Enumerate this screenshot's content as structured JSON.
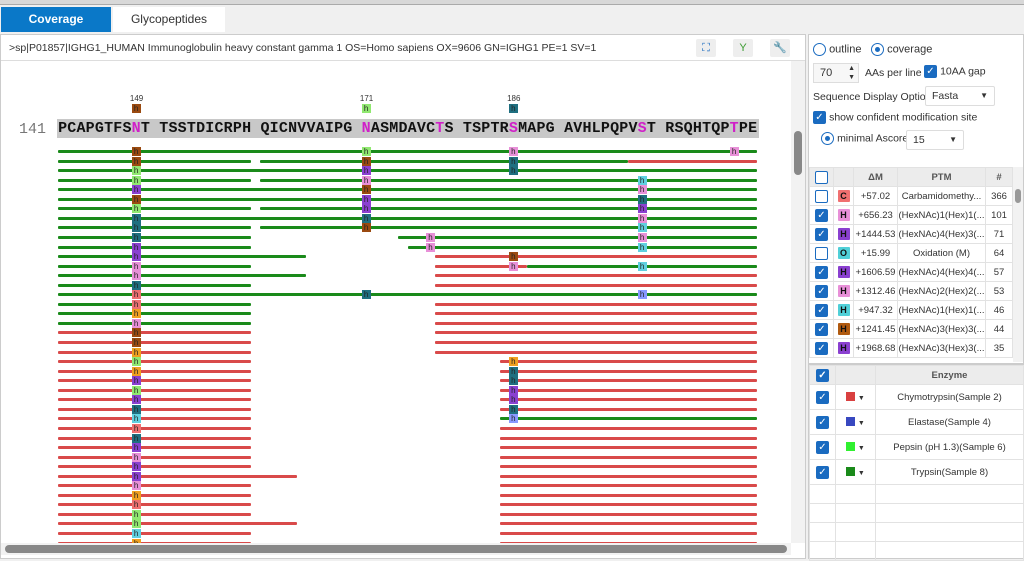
{
  "tabs": [
    {
      "label": "Coverage",
      "active": true
    },
    {
      "label": "Glycopeptides",
      "active": false
    }
  ],
  "header": {
    "title": ">sp|P01857|IGHG1_HUMAN Immunoglobulin heavy constant gamma 1 OS=Homo sapiens OX=9606 GN=IGHG1 PE=1 SV=1",
    "icons": [
      "expand-icon",
      "glycan-icon",
      "wrench-icon"
    ]
  },
  "coverage": {
    "line_start": "141",
    "sequence": "PCAPGTFSNTTSSTDICRPHQICNVVAIPGNASMDAVCTSTSPTRSMAPGAVHLPQPVSTRSQHTQPTPE",
    "highlighted_residues": [
      149,
      171,
      179,
      186,
      199,
      208
    ],
    "site_labels": [
      {
        "pos": 149,
        "label": "149",
        "color": "#9a4a10"
      },
      {
        "pos": 171,
        "label": "171",
        "color": "#90e870"
      },
      {
        "pos": 186,
        "label": "186",
        "color": "#1f6f80"
      }
    ],
    "enzyme_colors": [
      "#d94a4a",
      "#3848c0",
      "#30f030",
      "#1a8a1a"
    ],
    "mod_colors": {
      "br": "#9a4a10",
      "lg": "#90e870",
      "pk": "#e890d8",
      "pu": "#8a40d0",
      "te": "#1f6f80",
      "cy": "#60d0e0",
      "sa": "#ee7070",
      "or": "#f0a020",
      "lv": "#8899ff"
    },
    "rows": [
      {
        "p": [
          [
            141,
            210,
            3
          ]
        ],
        "m": [
          [
            149,
            "br"
          ],
          [
            171,
            "lg"
          ],
          [
            186,
            "pk"
          ],
          [
            208,
            "pk"
          ]
        ]
      },
      {
        "p": [
          [
            141,
            160,
            3
          ],
          [
            161,
            197,
            3
          ],
          [
            198,
            210,
            0
          ]
        ],
        "m": [
          [
            149,
            "br"
          ],
          [
            171,
            "br"
          ],
          [
            186,
            "te"
          ]
        ]
      },
      {
        "p": [
          [
            141,
            210,
            3
          ]
        ],
        "m": [
          [
            149,
            "lg"
          ],
          [
            171,
            "pu"
          ],
          [
            186,
            "te"
          ]
        ]
      },
      {
        "p": [
          [
            141,
            160,
            3
          ],
          [
            161,
            210,
            3
          ]
        ],
        "m": [
          [
            149,
            "lg"
          ],
          [
            171,
            "pk"
          ],
          [
            199,
            "cy"
          ]
        ]
      },
      {
        "p": [
          [
            141,
            210,
            3
          ]
        ],
        "m": [
          [
            149,
            "pu"
          ],
          [
            171,
            "br"
          ],
          [
            199,
            "pk"
          ]
        ]
      },
      {
        "p": [
          [
            141,
            210,
            3
          ]
        ],
        "m": [
          [
            149,
            "br"
          ],
          [
            171,
            "pu"
          ],
          [
            199,
            "te"
          ]
        ]
      },
      {
        "p": [
          [
            141,
            160,
            3
          ],
          [
            161,
            210,
            3
          ]
        ],
        "m": [
          [
            149,
            "lg"
          ],
          [
            171,
            "pu"
          ],
          [
            199,
            "pu"
          ]
        ]
      },
      {
        "p": [
          [
            141,
            210,
            3
          ]
        ],
        "m": [
          [
            149,
            "te"
          ],
          [
            171,
            "te"
          ],
          [
            199,
            "pk"
          ]
        ]
      },
      {
        "p": [
          [
            141,
            160,
            3
          ],
          [
            161,
            210,
            3
          ]
        ],
        "m": [
          [
            149,
            "te"
          ],
          [
            171,
            "br"
          ],
          [
            199,
            "cy"
          ]
        ]
      },
      {
        "p": [
          [
            141,
            160,
            3
          ],
          [
            175,
            210,
            3
          ]
        ],
        "m": [
          [
            149,
            "te"
          ],
          [
            178,
            "pk"
          ],
          [
            199,
            "pk"
          ]
        ]
      },
      {
        "p": [
          [
            141,
            160,
            3
          ],
          [
            176,
            210,
            3
          ]
        ],
        "m": [
          [
            149,
            "pu"
          ],
          [
            178,
            "pk"
          ],
          [
            199,
            "cy"
          ]
        ]
      },
      {
        "p": [
          [
            141,
            165,
            3
          ],
          [
            179,
            210,
            0
          ]
        ],
        "m": [
          [
            149,
            "pu"
          ],
          [
            186,
            "br"
          ]
        ]
      },
      {
        "p": [
          [
            141,
            160,
            3
          ],
          [
            179,
            187,
            0
          ],
          [
            188,
            210,
            3
          ]
        ],
        "m": [
          [
            149,
            "pk"
          ],
          [
            186,
            "pk"
          ],
          [
            199,
            "cy"
          ]
        ]
      },
      {
        "p": [
          [
            141,
            165,
            3
          ],
          [
            179,
            210,
            0
          ]
        ],
        "m": [
          [
            149,
            "pk"
          ]
        ]
      },
      {
        "p": [
          [
            141,
            160,
            3
          ],
          [
            179,
            210,
            0
          ]
        ],
        "m": [
          [
            149,
            "te"
          ]
        ]
      },
      {
        "p": [
          [
            141,
            210,
            3
          ]
        ],
        "m": [
          [
            149,
            "sa"
          ],
          [
            171,
            "te"
          ],
          [
            199,
            "lv"
          ]
        ]
      },
      {
        "p": [
          [
            141,
            160,
            3
          ],
          [
            179,
            210,
            0
          ]
        ],
        "m": [
          [
            149,
            "sa"
          ]
        ]
      },
      {
        "p": [
          [
            141,
            160,
            3
          ],
          [
            179,
            210,
            0
          ]
        ],
        "m": [
          [
            149,
            "or"
          ]
        ]
      },
      {
        "p": [
          [
            141,
            160,
            3
          ],
          [
            179,
            210,
            0
          ]
        ],
        "m": [
          [
            149,
            "pk"
          ]
        ]
      },
      {
        "p": [
          [
            141,
            160,
            0
          ],
          [
            179,
            210,
            0
          ]
        ],
        "m": [
          [
            149,
            "br"
          ]
        ]
      },
      {
        "p": [
          [
            141,
            160,
            0
          ],
          [
            179,
            210,
            0
          ]
        ],
        "m": [
          [
            149,
            "br"
          ]
        ]
      },
      {
        "p": [
          [
            141,
            160,
            0
          ],
          [
            179,
            210,
            0
          ]
        ],
        "m": [
          [
            149,
            "or"
          ]
        ]
      },
      {
        "p": [
          [
            141,
            160,
            0
          ],
          [
            185,
            210,
            0
          ]
        ],
        "m": [
          [
            149,
            "lg"
          ],
          [
            186,
            "or"
          ]
        ]
      },
      {
        "p": [
          [
            141,
            160,
            0
          ],
          [
            185,
            210,
            0
          ]
        ],
        "m": [
          [
            149,
            "or"
          ],
          [
            186,
            "te"
          ]
        ]
      },
      {
        "p": [
          [
            141,
            160,
            0
          ],
          [
            185,
            210,
            0
          ]
        ],
        "m": [
          [
            149,
            "pu"
          ],
          [
            186,
            "te"
          ]
        ]
      },
      {
        "p": [
          [
            141,
            160,
            0
          ],
          [
            185,
            210,
            0
          ]
        ],
        "m": [
          [
            149,
            "lg"
          ],
          [
            186,
            "pu"
          ]
        ]
      },
      {
        "p": [
          [
            141,
            160,
            0
          ],
          [
            185,
            210,
            0
          ]
        ],
        "m": [
          [
            149,
            "pu"
          ],
          [
            186,
            "pu"
          ]
        ]
      },
      {
        "p": [
          [
            141,
            160,
            0
          ],
          [
            185,
            210,
            0
          ]
        ],
        "m": [
          [
            149,
            "te"
          ],
          [
            186,
            "te"
          ]
        ]
      },
      {
        "p": [
          [
            141,
            160,
            0
          ],
          [
            185,
            210,
            3
          ]
        ],
        "m": [
          [
            149,
            "cy"
          ],
          [
            186,
            "lv"
          ]
        ]
      },
      {
        "p": [
          [
            141,
            160,
            0
          ],
          [
            185,
            210,
            0
          ]
        ],
        "m": [
          [
            149,
            "sa"
          ]
        ]
      },
      {
        "p": [
          [
            141,
            160,
            0
          ],
          [
            185,
            210,
            0
          ]
        ],
        "m": [
          [
            149,
            "te"
          ]
        ]
      },
      {
        "p": [
          [
            141,
            160,
            0
          ],
          [
            185,
            210,
            0
          ]
        ],
        "m": [
          [
            149,
            "pu"
          ]
        ]
      },
      {
        "p": [
          [
            141,
            160,
            0
          ],
          [
            185,
            210,
            0
          ]
        ],
        "m": [
          [
            149,
            "pk"
          ]
        ]
      },
      {
        "p": [
          [
            141,
            160,
            0
          ],
          [
            185,
            210,
            0
          ]
        ],
        "m": [
          [
            149,
            "pu"
          ]
        ]
      },
      {
        "p": [
          [
            141,
            164,
            0
          ],
          [
            185,
            210,
            0
          ]
        ],
        "m": [
          [
            149,
            "pu"
          ]
        ]
      },
      {
        "p": [
          [
            141,
            160,
            0
          ],
          [
            185,
            210,
            0
          ]
        ],
        "m": [
          [
            149,
            "pk"
          ]
        ]
      },
      {
        "p": [
          [
            141,
            160,
            0
          ],
          [
            185,
            210,
            0
          ]
        ],
        "m": [
          [
            149,
            "or"
          ]
        ]
      },
      {
        "p": [
          [
            141,
            160,
            0
          ],
          [
            185,
            210,
            0
          ]
        ],
        "m": [
          [
            149,
            "sa"
          ]
        ]
      },
      {
        "p": [
          [
            141,
            160,
            0
          ],
          [
            185,
            210,
            0
          ]
        ],
        "m": [
          [
            149,
            "lg"
          ]
        ]
      },
      {
        "p": [
          [
            141,
            164,
            0
          ],
          [
            185,
            210,
            0
          ]
        ],
        "m": [
          [
            149,
            "lg"
          ]
        ]
      },
      {
        "p": [
          [
            141,
            160,
            0
          ],
          [
            185,
            210,
            0
          ]
        ],
        "m": [
          [
            149,
            "cy"
          ]
        ]
      },
      {
        "p": [
          [
            141,
            160,
            0
          ],
          [
            185,
            210,
            0
          ]
        ],
        "m": [
          [
            149,
            "or"
          ]
        ]
      },
      {
        "p": [
          [
            141,
            160,
            0
          ],
          [
            186,
            210,
            3
          ]
        ],
        "m": [
          [
            149,
            "br"
          ],
          [
            199,
            "sa"
          ]
        ]
      },
      {
        "p": [
          [
            141,
            160,
            0
          ],
          [
            186,
            210,
            3
          ]
        ],
        "m": [
          [
            149,
            "sa"
          ],
          [
            199,
            "or"
          ]
        ]
      },
      {
        "p": [
          [
            141,
            160,
            0
          ],
          [
            186,
            210,
            3
          ]
        ],
        "m": [
          [
            149,
            "or"
          ],
          [
            199,
            "lg"
          ]
        ]
      },
      {
        "p": [
          [
            141,
            160,
            0
          ],
          [
            186,
            210,
            3
          ]
        ],
        "m": [
          [
            149,
            "br"
          ],
          [
            199,
            "pu"
          ]
        ]
      }
    ]
  },
  "options": {
    "outline_label": "outline",
    "coverage_label": "coverage",
    "mode": "coverage",
    "aas_per_line": "70",
    "aas_per_line_label": "AAs per line",
    "gap_label": "10AA gap",
    "gap_checked": true,
    "display_option_label": "Sequence Display Option",
    "display_option_value": "Fasta",
    "confident_label": "show confident modification site",
    "confident_checked": true,
    "ascore_label": "minimal Ascore",
    "ascore_value": "15"
  },
  "ptm_table": {
    "headers": [
      "",
      "",
      "ΔM",
      "PTM",
      "#"
    ],
    "rows": [
      {
        "checked": false,
        "badge": "C",
        "color": "#f07070",
        "dm": "+57.02",
        "ptm": "Carbamidomethy...",
        "count": "366"
      },
      {
        "checked": true,
        "badge": "H",
        "color": "#e890d8",
        "dm": "+656.23",
        "ptm": "(HexNAc)1(Hex)1(...",
        "count": "101"
      },
      {
        "checked": true,
        "badge": "H",
        "color": "#8a40d0",
        "dm": "+1444.53",
        "ptm": "(HexNAc)4(Hex)3(...",
        "count": "71"
      },
      {
        "checked": false,
        "badge": "O",
        "color": "#50d0d8",
        "dm": "+15.99",
        "ptm": "Oxidation (M)",
        "count": "64"
      },
      {
        "checked": true,
        "badge": "H",
        "color": "#8a40d0",
        "dm": "+1606.59",
        "ptm": "(HexNAc)4(Hex)4(...",
        "count": "57"
      },
      {
        "checked": true,
        "badge": "H",
        "color": "#e890d8",
        "dm": "+1312.46",
        "ptm": "(HexNAc)2(Hex)2(...",
        "count": "53"
      },
      {
        "checked": true,
        "badge": "H",
        "color": "#50d0d8",
        "dm": "+947.32",
        "ptm": "(HexNAc)1(Hex)1(...",
        "count": "46"
      },
      {
        "checked": true,
        "badge": "H",
        "color": "#b05a10",
        "dm": "+1241.45",
        "ptm": "(HexNAc)3(Hex)3(...",
        "count": "44"
      },
      {
        "checked": true,
        "badge": "H",
        "color": "#8a40d0",
        "dm": "+1968.68",
        "ptm": "(HexNAc)3(Hex)3(...",
        "count": "35"
      }
    ]
  },
  "enzyme_table": {
    "header": "Enzyme",
    "rows": [
      {
        "checked": true,
        "color": "#d94040",
        "name": "Chymotrypsin(Sample 2)"
      },
      {
        "checked": true,
        "color": "#3848c0",
        "name": "Elastase(Sample 4)"
      },
      {
        "checked": true,
        "color": "#30f030",
        "name": "Pepsin (pH 1.3)(Sample 6)"
      },
      {
        "checked": true,
        "color": "#1a8a1a",
        "name": "Trypsin(Sample 8)"
      }
    ]
  }
}
